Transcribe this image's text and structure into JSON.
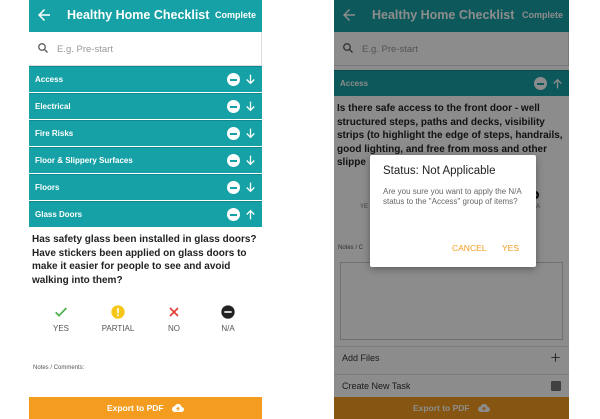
{
  "app": {
    "title": "Healthy Home Checklist",
    "complete_label": "Complete"
  },
  "search": {
    "placeholder": "E.g. Pre-start"
  },
  "left": {
    "groups": [
      {
        "label": "Access"
      },
      {
        "label": "Electrical"
      },
      {
        "label": "Fire Risks"
      },
      {
        "label": "Floor & Slippery Surfaces"
      },
      {
        "label": "Floors"
      },
      {
        "label": "Glass Doors"
      }
    ],
    "question": "Has safety glass been installed in glass doors? Have stickers been applied on glass doors to make it easier for people to see and avoid walking into them?",
    "options": [
      {
        "label": "YES",
        "icon": "check-icon",
        "color": "#4caf50"
      },
      {
        "label": "PARTIAL",
        "icon": "exclamation-circle-icon",
        "color": "#f5c518"
      },
      {
        "label": "NO",
        "icon": "cross-icon",
        "color": "#e53935"
      },
      {
        "label": "N/A",
        "icon": "minus-circle-icon",
        "color": "#222222"
      }
    ],
    "notes_label": "Notes / Comments:"
  },
  "right": {
    "group_label": "Access",
    "question": "Is there safe access to the front door - well structured steps, paths and decks, visibility strips (to highlight the edge of steps, handrails, good lighting, and free from moss and other slippe",
    "hint_yes": "YE",
    "hint_na": "A",
    "notes_label": "Notes / C",
    "add_files_label": "Add Files",
    "create_task_label": "Create New Task",
    "dialog": {
      "title": "Status: Not Applicable",
      "body": "Are you sure you want to apply the N/A status to the \"Access\" group of items?",
      "cancel_label": "CANCEL",
      "yes_label": "YES"
    }
  },
  "export": {
    "label": "Export to PDF",
    "icon": "cloud-upload-icon"
  },
  "colors": {
    "teal": "#16a1a6",
    "orange": "#f39c1f"
  }
}
